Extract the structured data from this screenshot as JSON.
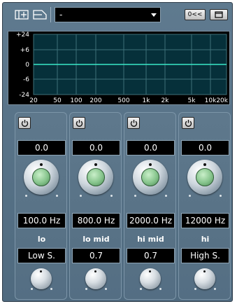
{
  "toolbar": {
    "preset_value": "-",
    "compare_label": "0<<"
  },
  "display": {
    "y_labels": [
      "+24",
      "+6",
      "0",
      "-6",
      "-24"
    ],
    "x_labels": [
      "20",
      "50",
      "100",
      "200",
      "500",
      "1k",
      "2k",
      "5k",
      "10k",
      "20k"
    ]
  },
  "bands": [
    {
      "label": "lo",
      "gain": "0.0",
      "freq": "100.0 Hz",
      "mode": "Low S."
    },
    {
      "label": "lo mid",
      "gain": "0.0",
      "freq": "800.0 Hz",
      "mode": "0.7"
    },
    {
      "label": "hi mid",
      "gain": "0.0",
      "freq": "2000.0 Hz",
      "mode": "0.7"
    },
    {
      "label": "hi",
      "gain": "0.0",
      "freq": "12000 Hz",
      "mode": "High S."
    }
  ],
  "colors": {
    "panel": "#5a7589",
    "curve": "#39e8c8",
    "grid": "#3e6f78",
    "knob_green": "#86c48c"
  }
}
